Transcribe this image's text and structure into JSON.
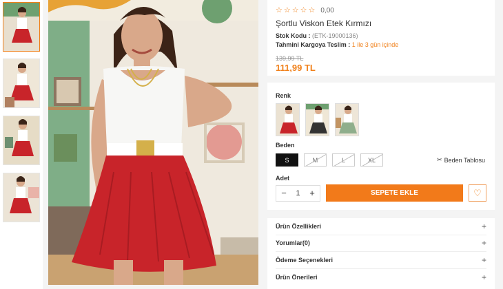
{
  "product": {
    "rating_value": "0,00",
    "title": "Şortlu Viskon Etek Kırmızı",
    "stock_code_label": "Stok Kodu :",
    "stock_code_value": "(ETK-19000136)",
    "shipping_label": "Tahmini Kargoya Teslim :",
    "shipping_value": "1 ile 3 gün içinde",
    "old_price": "139,99 TL",
    "new_price": "111,99 TL"
  },
  "options": {
    "color_label": "Renk",
    "size_label": "Beden",
    "sizes": [
      "S",
      "M",
      "L",
      "XL"
    ],
    "selected_size": "S",
    "size_table_label": "Beden Tablosu",
    "qty_label": "Adet",
    "qty_value": "1",
    "qty_minus": "−",
    "qty_plus": "+",
    "add_to_cart_label": "SEPETE EKLE"
  },
  "accordion": [
    {
      "label": "Ürün Özellikleri"
    },
    {
      "label": "Yorumlar(0)"
    },
    {
      "label": "Ödeme Seçenekleri"
    },
    {
      "label": "Ürün Önerileri"
    }
  ],
  "icons": {
    "star": "☆",
    "heart": "♡",
    "ruler": "✂",
    "plus": "+"
  },
  "colors": {
    "accent": "#f27a1a",
    "skirt_red": "#c8242a",
    "selected_size_bg": "#111111"
  }
}
